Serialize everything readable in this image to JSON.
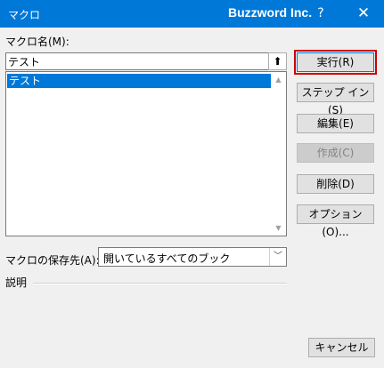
{
  "window": {
    "title": "マクロ",
    "brand": "Buzzword Inc.",
    "help_glyph": "?",
    "close_glyph": "✕"
  },
  "macro_name": {
    "label": "マクロ名(M):",
    "value": "テスト",
    "upload_glyph": "⬆"
  },
  "macro_list": {
    "items": [
      "テスト"
    ],
    "selected_index": 0
  },
  "buttons": {
    "run": "実行(R)",
    "step_into": "ステップ イン(S)",
    "edit": "編集(E)",
    "create": "作成(C)",
    "delete": "削除(D)",
    "options": "オプション(O)...",
    "cancel": "キャンセル"
  },
  "macros_in": {
    "label": "マクロの保存先(A):",
    "value": "開いているすべてのブック"
  },
  "description": {
    "label": "説明"
  },
  "colors": {
    "accent": "#0078d7",
    "focus_ring": "#d00000"
  }
}
